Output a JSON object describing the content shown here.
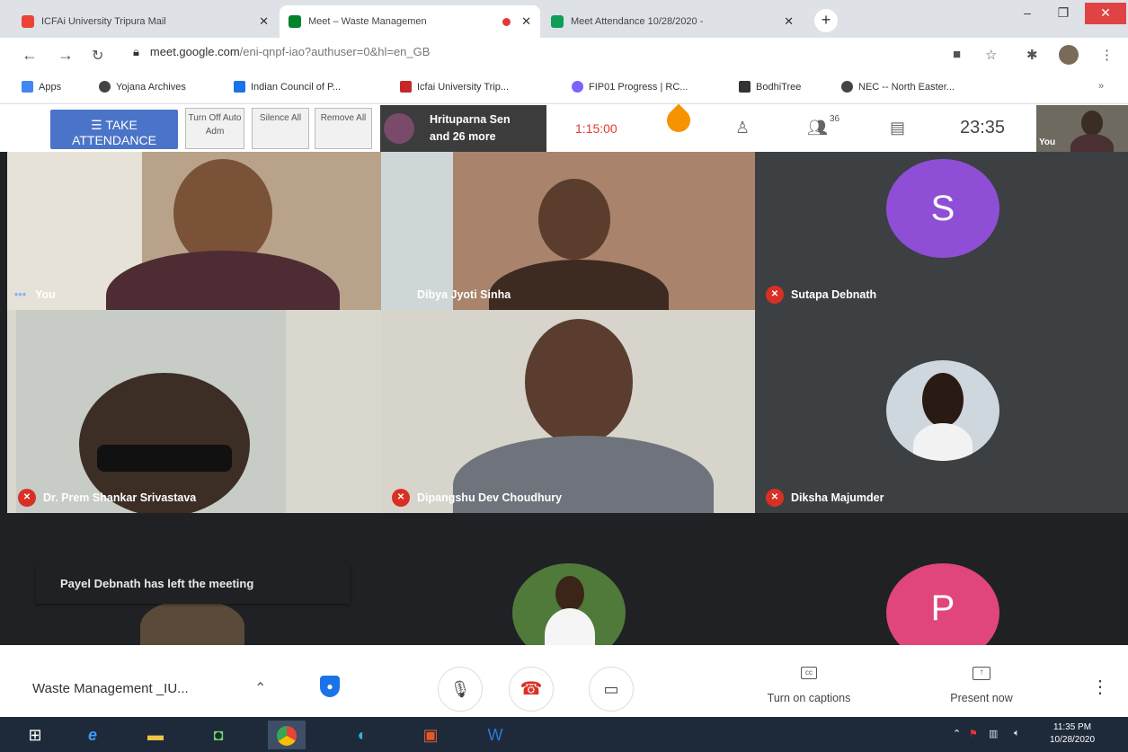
{
  "browser": {
    "tabs": [
      {
        "title": "ICFAi University Tripura Mail",
        "favicon_color": "#ea4335"
      },
      {
        "title": "Meet – Waste Managemen",
        "favicon_color": "#00832d"
      },
      {
        "title": "Meet Attendance 10/28/2020 -",
        "favicon_color": "#0f9d58"
      }
    ],
    "new_tab": "+",
    "url_host": "meet.google.com",
    "url_path": "/eni-qnpf-iao?authuser=0&hl=en_GB"
  },
  "bookmarks": [
    {
      "label": "Apps",
      "color": "#4285f4"
    },
    {
      "label": "Yojana Archives",
      "color": "#444444"
    },
    {
      "label": "Indian Council of P...",
      "color": "#1a73e8"
    },
    {
      "label": "Icfai University Trip...",
      "color": "#c62828"
    },
    {
      "label": "FIP01 Progress | RC...",
      "color": "#7b61ff"
    },
    {
      "label": "BodhiTree",
      "color": "#333333"
    },
    {
      "label": "NEC -- North Easter...",
      "color": "#444444"
    }
  ],
  "meet_top": {
    "take_attendance": "TAKE ATTENDANCE",
    "turn_off_auto": "Turn Off Auto Adm",
    "silence_all": "Silence All",
    "remove_all": "Remove All",
    "presenter_name": "Hrituparna Sen",
    "presenter_more": "and 26 more",
    "timer": "1:15:00",
    "participant_count": "36",
    "clock": "23:35",
    "self_label": "You"
  },
  "participants": [
    {
      "name": "You",
      "video": true
    },
    {
      "name": "Dibya Jyoti Sinha",
      "video": true
    },
    {
      "name": "Sutapa Debnath",
      "initial": "S",
      "avatar_color": "#8e4fd6",
      "muted": true
    },
    {
      "name": "Dr. Prem Shankar Srivastava",
      "video": true,
      "muted": true
    },
    {
      "name": "Dipangshu Dev Choudhury",
      "video": true,
      "muted": true
    },
    {
      "name": "Diksha Majumder",
      "muted": true
    },
    {
      "name": "P",
      "initial": "P",
      "avatar_color": "#e0457b"
    }
  ],
  "toast": "Payel Debnath has left the meeting",
  "controls": {
    "meeting_title": "Waste Management _IU...",
    "captions_label": "Turn on captions",
    "present_label": "Present now"
  },
  "taskbar": {
    "time": "11:35 PM",
    "date": "10/28/2020"
  }
}
